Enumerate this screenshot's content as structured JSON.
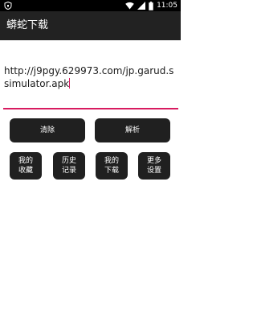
{
  "status_bar": {
    "time": "11:05",
    "icons": [
      "shield-icon",
      "wifi-icon",
      "signal-icon",
      "battery-icon"
    ]
  },
  "app_bar": {
    "title": "蟒蛇下载"
  },
  "url_input": {
    "value": "http://j9pgy.629973.com/jp.garud.ssimulator.apk"
  },
  "buttons": {
    "clear": "清除",
    "parse": "解析",
    "favorites": "我的收藏",
    "history": "历史记录",
    "downloads": "我的下载",
    "more_settings": "更多设置"
  },
  "colors": {
    "app_bar": "#222222",
    "accent": "#d81b60",
    "button_bg": "#202020",
    "button_text": "#ffffff"
  }
}
